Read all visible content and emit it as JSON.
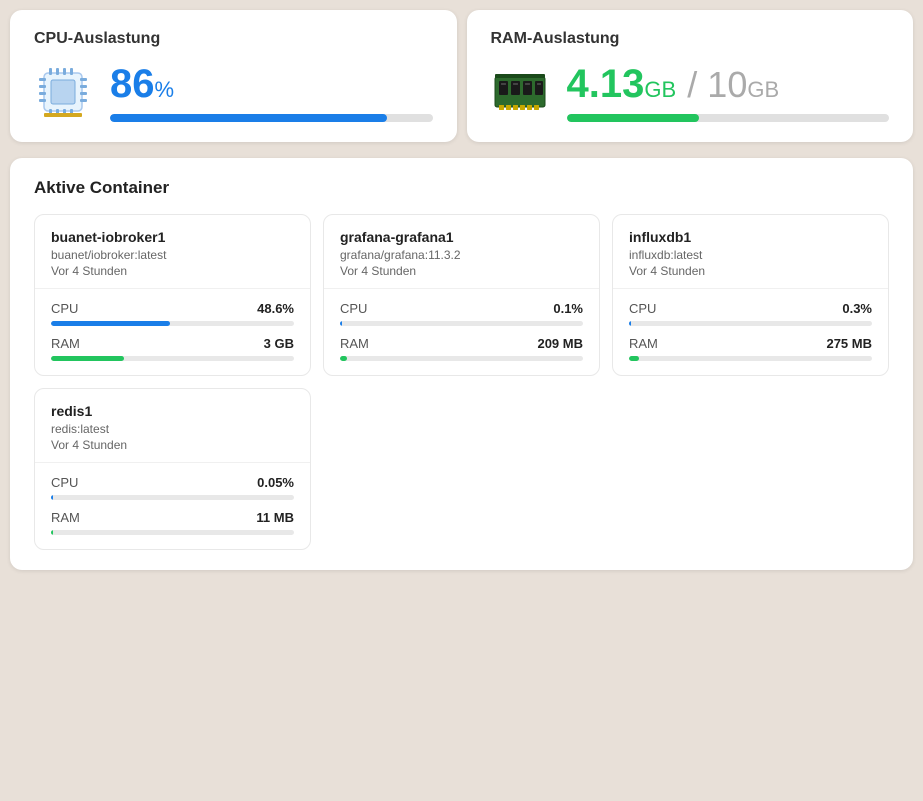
{
  "cpu_section": {
    "title": "CPU-Auslastung",
    "value": "86",
    "unit": "%",
    "bar_percent": 86
  },
  "ram_section": {
    "title": "RAM-Auslastung",
    "used": "4.13",
    "used_unit": "GB",
    "slash": "/",
    "total": "10",
    "total_unit": "GB",
    "bar_percent": 41
  },
  "containers_section": {
    "title": "Aktive Container",
    "containers": [
      {
        "name": "buanet-iobroker1",
        "image": "buanet/iobroker:latest",
        "time": "Vor 4 Stunden",
        "cpu_label": "CPU",
        "cpu_value": "48.6%",
        "cpu_bar": 49,
        "ram_label": "RAM",
        "ram_value": "3 GB",
        "ram_bar": 30
      },
      {
        "name": "grafana-grafana1",
        "image": "grafana/grafana:11.3.2",
        "time": "Vor 4 Stunden",
        "cpu_label": "CPU",
        "cpu_value": "0.1%",
        "cpu_bar": 1,
        "ram_label": "RAM",
        "ram_value": "209 MB",
        "ram_bar": 3
      },
      {
        "name": "influxdb1",
        "image": "influxdb:latest",
        "time": "Vor 4 Stunden",
        "cpu_label": "CPU",
        "cpu_value": "0.3%",
        "cpu_bar": 1,
        "ram_label": "RAM",
        "ram_value": "275 MB",
        "ram_bar": 4
      },
      {
        "name": "redis1",
        "image": "redis:latest",
        "time": "Vor 4 Stunden",
        "cpu_label": "CPU",
        "cpu_value": "0.05%",
        "cpu_bar": 0,
        "ram_label": "RAM",
        "ram_value": "11 MB",
        "ram_bar": 1
      }
    ]
  }
}
